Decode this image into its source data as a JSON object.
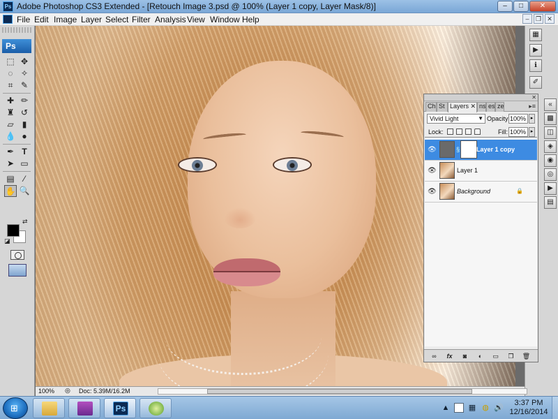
{
  "titlebar": {
    "app_icon": "Ps",
    "title": "Adobe Photoshop CS3 Extended - [Retouch Image 3.psd @ 100% (Layer 1 copy, Layer Mask/8)]",
    "minimize": "–",
    "maximize": "□",
    "close": "✕"
  },
  "menu": {
    "items": [
      "File",
      "Edit",
      "Image",
      "Layer",
      "Select",
      "Filter",
      "Analysis",
      "View",
      "Window",
      "Help"
    ],
    "doc_minimize": "–",
    "doc_restore": "❐",
    "doc_close": "✕"
  },
  "tools": {
    "logo": "Ps",
    "icons": [
      "move-icon",
      "marquee-icon",
      "lasso-icon",
      "magic-wand-icon",
      "crop-icon",
      "slice-icon",
      "healing-brush-icon",
      "brush-icon",
      "clone-stamp-icon",
      "history-brush-icon",
      "eraser-icon",
      "gradient-icon",
      "blur-icon",
      "dodge-icon",
      "pen-icon",
      "type-icon",
      "path-select-icon",
      "shape-icon",
      "notes-icon",
      "eyedropper-icon",
      "hand-icon",
      "zoom-icon"
    ],
    "foreground_color": "#000000",
    "background_color": "#ffffff"
  },
  "layers_panel": {
    "tabs": [
      "Ch",
      "St",
      "Layers",
      "ns",
      "es",
      "ze"
    ],
    "active_tab": "Layers",
    "blend_mode": "Vivid Light",
    "opacity_label": "Opacity:",
    "opacity_value": "100%",
    "lock_label": "Lock:",
    "fill_label": "Fill:",
    "fill_value": "100%",
    "layers": [
      {
        "name": "Layer 1 copy",
        "selected": true,
        "italic": false,
        "locked": false,
        "has_mask": true
      },
      {
        "name": "Layer 1",
        "selected": false,
        "italic": false,
        "locked": false,
        "has_mask": false
      },
      {
        "name": "Background",
        "selected": false,
        "italic": true,
        "locked": true,
        "has_mask": false
      }
    ],
    "bottom_buttons": [
      "link-icon",
      "fx-icon",
      "mask-icon",
      "adjustment-icon",
      "group-icon",
      "new-layer-icon",
      "trash-icon"
    ]
  },
  "status": {
    "zoom": "100%",
    "doc": "Doc: 5.39M/16.2M"
  },
  "taskbar": {
    "apps": [
      "explorer-icon",
      "winrar-icon",
      "photoshop-icon",
      "app-icon"
    ],
    "active_app": "photoshop-icon",
    "photoshop_label": "Ps",
    "time": "3:37 PM",
    "date": "12/16/2014"
  }
}
